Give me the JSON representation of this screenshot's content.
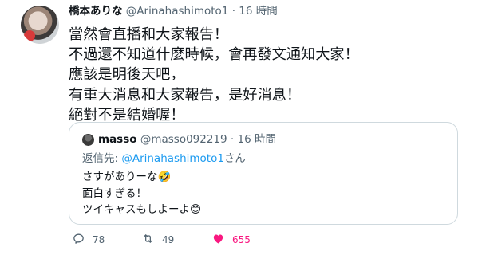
{
  "tweet": {
    "author_name": "橋本ありな",
    "author_handle": "@Arinahashimoto1",
    "separator": "·",
    "time": "16 時間",
    "lines": [
      "當然會直播和大家報告！",
      "不過還不知道什麼時候，會再發文通知大家！",
      "應該是明後天吧，",
      "有重大消息和大家報告，是好消息！",
      "絕對不是結婚喔！"
    ]
  },
  "quoted": {
    "author_name": "masso",
    "author_handle": "@masso092219",
    "separator": "·",
    "time": "16 時間",
    "reply_prefix": "返信先: ",
    "reply_to": "@Arinahashimoto1",
    "reply_suffix": "さん",
    "lines": [
      "さすがありーな🤣",
      "面白すぎる！",
      "ツイキャスもしよーよ😊"
    ]
  },
  "actions": {
    "reply_count": "78",
    "retweet_count": "49",
    "like_count": "655"
  },
  "icons": {
    "reply": "reply-icon",
    "retweet": "retweet-icon",
    "like": "heart-icon"
  },
  "colors": {
    "like": "#f91880",
    "mention": "#1d9bf0",
    "secondary_text": "#536471"
  }
}
